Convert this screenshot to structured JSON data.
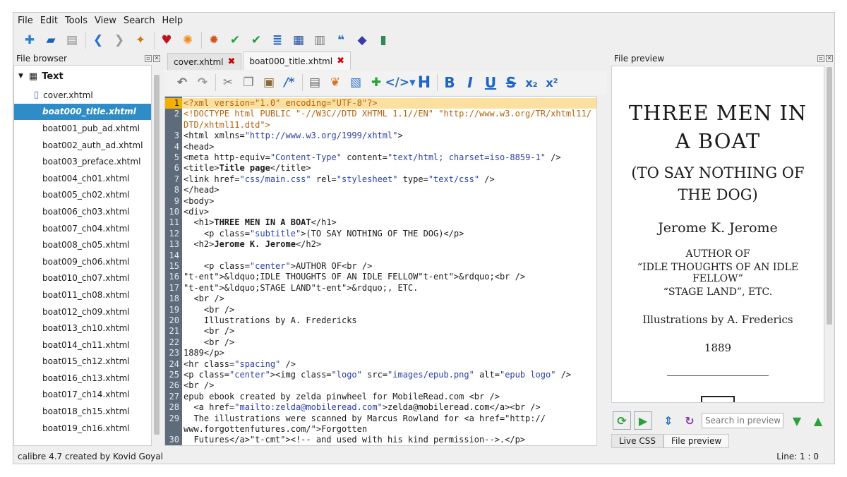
{
  "menu": {
    "file": "File",
    "edit": "Edit",
    "tools": "Tools",
    "view": "View",
    "search": "Search",
    "help": "Help"
  },
  "toolbar_icons": [
    "new-file-icon",
    "open-book-icon",
    "save-icon",
    "back-arrow-icon",
    "forward-arrow-icon",
    "pin-icon",
    "heart-icon",
    "lifebuoy-icon",
    "debug-bug-icon",
    "spellcheck-icon",
    "check-book-icon",
    "toc-icon",
    "book-blue-icon",
    "font-file-icon",
    "quote-icon",
    "highlight-icon",
    "report-icon"
  ],
  "file_browser": {
    "title": "File browser",
    "root": "Text",
    "items": [
      "cover.xhtml",
      "boat000_title.xhtml",
      "boat001_pub_ad.xhtml",
      "boat002_auth_ad.xhtml",
      "boat003_preface.xhtml",
      "boat004_ch01.xhtml",
      "boat005_ch02.xhtml",
      "boat006_ch03.xhtml",
      "boat007_ch04.xhtml",
      "boat008_ch05.xhtml",
      "boat009_ch06.xhtml",
      "boat010_ch07.xhtml",
      "boat011_ch08.xhtml",
      "boat012_ch09.xhtml",
      "boat013_ch10.xhtml",
      "boat014_ch11.xhtml",
      "boat015_ch12.xhtml",
      "boat016_ch13.xhtml",
      "boat017_ch14.xhtml",
      "boat018_ch15.xhtml",
      "boat019_ch16.xhtml"
    ],
    "selected_index": 1
  },
  "tabs": [
    {
      "label": "cover.xhtml",
      "active": false
    },
    {
      "label": "boat000_title.xhtml",
      "active": true
    }
  ],
  "editor": {
    "lines": [
      "<?xml version=\"1.0\" encoding=\"UTF-8\"?>",
      "<!DOCTYPE html PUBLIC \"-//W3C//DTD XHTML 1.1//EN\" \"http://www.w3.org/TR/xhtml11/",
      "DTD/xhtml11.dtd\">",
      "<html xmlns=\"http://www.w3.org/1999/xhtml\">",
      "<head>",
      "<meta http-equiv=\"Content-Type\" content=\"text/html; charset=iso-8859-1\" />",
      "<title>Title page</title>",
      "<link href=\"css/main.css\" rel=\"stylesheet\" type=\"text/css\" />",
      "</head>",
      "<body>",
      "<div>",
      "  <h1>THREE MEN IN A BOAT</h1>",
      "    <p class=\"subtitle\">(TO SAY NOTHING OF THE DOG)</p>",
      "  <h2>Jerome K. Jerome</h2>",
      "",
      "    <p class=\"center\">AUTHOR OF<br />",
      "&ldquo;IDLE THOUGHTS OF AN IDLE FELLOW&rdquo;<br />",
      "&ldquo;STAGE LAND&rdquo;, ETC.",
      "  <br />",
      "    <br />",
      "    Illustrations by A. Fredericks",
      "    <br />",
      "    <br />",
      "1889</p>",
      "<hr class=\"spacing\" />",
      "<p class=\"center\"><img class=\"logo\" src=\"images/epub.png\" alt=\"epub logo\" />",
      "<br />",
      "epub ebook created by zelda pinwheel for MobileRead.com <br />",
      "  <a href=\"mailto:zelda@mobileread.com\">zelda@mobileread.com</a><br />",
      "  The illustrations were scanned by Marcus Rowland for <a href=\"http://",
      "www.forgottenfutures.com/\">Forgotten",
      "  Futures</a><!-- and used with his kind permission-->.</p>"
    ],
    "line_numbers": [
      "1",
      "2",
      "",
      "3",
      "4",
      "5",
      "6",
      "7",
      "8",
      "9",
      "10",
      "11",
      "12",
      "13",
      "14",
      "15",
      "16",
      "17",
      "18",
      "19",
      "20",
      "21",
      "22",
      "23",
      "24",
      "25",
      "26",
      "27",
      "28",
      "29",
      "",
      "30"
    ]
  },
  "file_preview": {
    "title": "File preview",
    "h1": "THREE MEN IN A BOAT",
    "subtitle": "(TO SAY NOTHING OF THE DOG)",
    "h2": "Jerome K. Jerome",
    "author_of": "AUTHOR OF",
    "idle": "“IDLE THOUGHTS OF AN IDLE FELLOW”",
    "stage": "“STAGE LAND”, ETC.",
    "illus": "Illustrations by A. Frederics",
    "year": "1889",
    "search_placeholder": "Search in preview",
    "tabs": [
      "Live CSS",
      "File preview"
    ]
  },
  "status": {
    "left": "calibre 4.7 created by Kovid Goyal",
    "right": "Line: 1 : 0"
  },
  "colors": {
    "selection": "#308cc6",
    "gutter": "#5d6b7a",
    "current_line": "#fbe0a0"
  }
}
